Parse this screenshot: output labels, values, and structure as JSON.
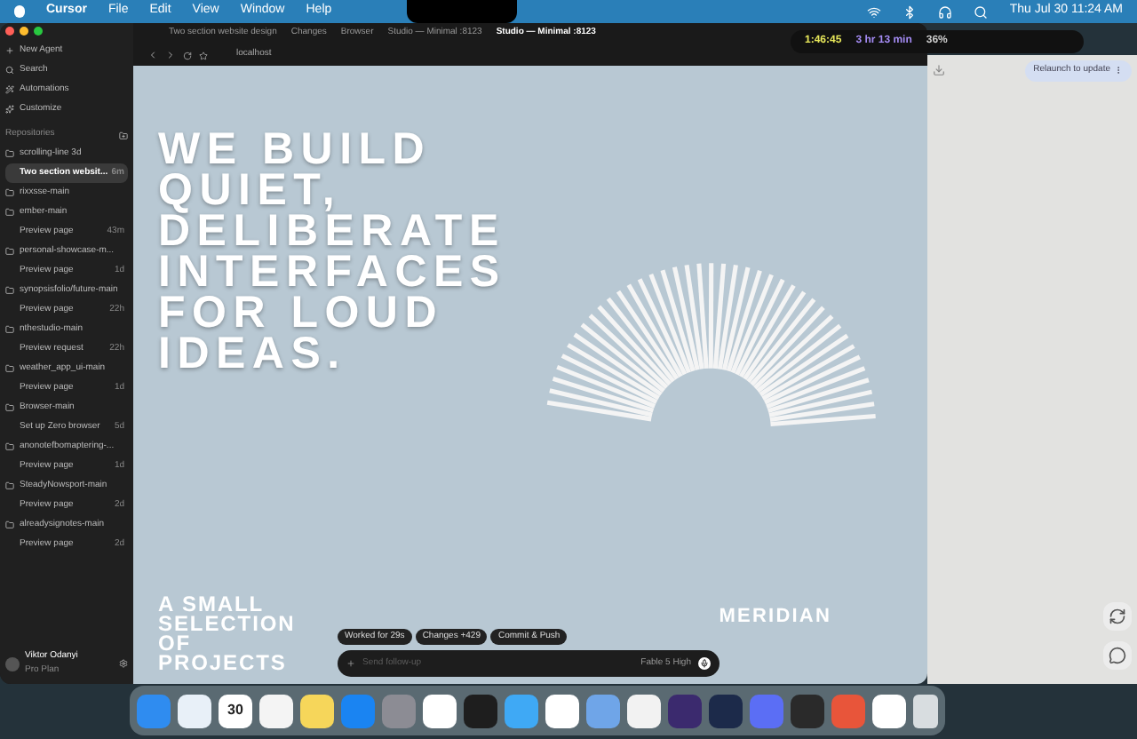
{
  "menu_bar": {
    "app": "Cursor",
    "menus": [
      "File",
      "Edit",
      "View",
      "Window",
      "Help"
    ],
    "clock": "Thu Jul 30  11:24 AM"
  },
  "timer_overlay": {
    "elapsed": "1:46:45",
    "remaining": "3 hr 13 min",
    "battery": "36%"
  },
  "sidebar": {
    "actions": [
      "New Agent",
      "Search",
      "Automations",
      "Customize"
    ],
    "section": "Repositories",
    "repos": [
      {
        "name": "scrolling-line 3d",
        "children": [
          {
            "title": "Two section websit...",
            "time": "6m",
            "selected": true
          }
        ]
      },
      {
        "name": "rixxsse-main"
      },
      {
        "name": "ember-main",
        "children": [
          {
            "title": "Preview page",
            "time": "43m",
            "selected": false
          }
        ]
      },
      {
        "name": "personal-showcase-m...",
        "children": [
          {
            "title": "Preview page",
            "time": "1d",
            "selected": false
          }
        ]
      },
      {
        "name": "synopsisfolio/future-main",
        "children": [
          {
            "title": "Preview page",
            "time": "22h",
            "selected": false
          }
        ]
      },
      {
        "name": "nthestudio-main",
        "children": [
          {
            "title": "Preview request",
            "time": "22h",
            "selected": false
          }
        ]
      },
      {
        "name": "weather_app_ui-main",
        "children": [
          {
            "title": "Preview page",
            "time": "1d",
            "selected": false
          }
        ]
      },
      {
        "name": "Browser-main",
        "children": [
          {
            "title": "Set up Zero browser",
            "time": "5d",
            "selected": false
          }
        ]
      },
      {
        "name": "anonotefbomaptering-...",
        "children": [
          {
            "title": "Preview page",
            "time": "1d",
            "selected": false
          }
        ]
      },
      {
        "name": "SteadyNowsport-main",
        "children": [
          {
            "title": "Preview page",
            "time": "2d",
            "selected": false
          }
        ]
      },
      {
        "name": "alreadysignotes-main",
        "children": [
          {
            "title": "Preview page",
            "time": "2d",
            "selected": false
          }
        ]
      }
    ],
    "user": {
      "name": "Viktor Odanyi",
      "plan": "Pro Plan"
    }
  },
  "tabs": [
    {
      "label": "Two section website design",
      "selected": false
    },
    {
      "label": "Changes",
      "selected": false
    },
    {
      "label": "Browser",
      "selected": false
    },
    {
      "label": "Studio — Minimal :8123",
      "selected": false
    },
    {
      "label": "Studio — Minimal :8123",
      "selected": true
    }
  ],
  "address": "localhost",
  "hero": {
    "headline": "WE BUILD QUIET, DELIBERATE INTERFACES FOR LOUD IDEAS.",
    "projects": "A SMALL SELECTION OF PROJECTS",
    "project_name": "MERIDIAN"
  },
  "composer": {
    "chips": [
      "Worked for 29s",
      "Changes +429",
      "Commit & Push"
    ],
    "placeholder": "Send follow-up",
    "model": "Fable 5 High"
  },
  "right_panel": {
    "button": "Relaunch to update"
  },
  "dock": [
    {
      "color": "#2f8cf0"
    },
    {
      "color": "#e8f0f8"
    },
    {
      "color": "#ffffff",
      "text": "30"
    },
    {
      "color": "#f4f4f4"
    },
    {
      "color": "#f6d65a"
    },
    {
      "color": "#1a84f2"
    },
    {
      "color": "#8c8c94"
    },
    {
      "color": "#ffffff"
    },
    {
      "color": "#1e1e1e"
    },
    {
      "color": "#3fa9f5"
    },
    {
      "color": "#ffffff"
    },
    {
      "color": "#6fa5e8"
    },
    {
      "color": "#f2f2f2"
    },
    {
      "color": "#3b2a6e"
    },
    {
      "color": "#1c2a4a"
    },
    {
      "color": "#5b6ef5"
    },
    {
      "color": "#2a2a2a"
    },
    {
      "color": "#e8553a"
    },
    {
      "color": "#ffffff"
    }
  ]
}
